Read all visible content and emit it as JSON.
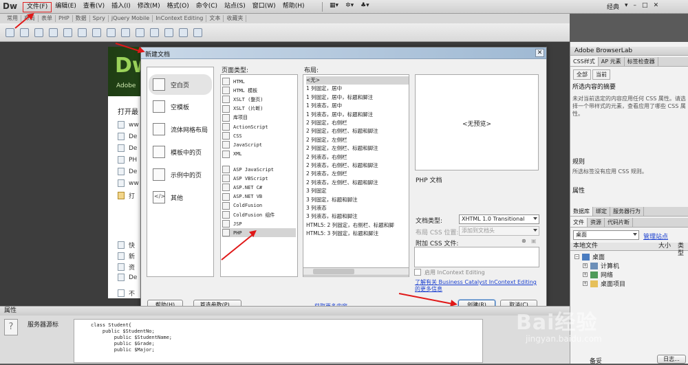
{
  "app": {
    "logo": "Dw"
  },
  "menubar": {
    "items": [
      "文件(F)",
      "编辑(E)",
      "查看(V)",
      "插入(I)",
      "修改(M)",
      "格式(O)",
      "命令(C)",
      "站点(S)",
      "窗口(W)",
      "帮助(H)"
    ],
    "workspace": "经典",
    "window_buttons": [
      "–",
      "□",
      "✕"
    ]
  },
  "insert_tabs": [
    "常用",
    "布局",
    "表单",
    "PHP",
    "数据",
    "Spry",
    "jQuery Mobile",
    "InContext Editing",
    "文本",
    "收藏夹"
  ],
  "welcome": {
    "dw": "Dw",
    "adobe": "Adobe",
    "open_recent": "打开最",
    "recent_files": [
      "ww",
      "De",
      "De",
      "PH",
      "De",
      "ww",
      "打"
    ],
    "lower_items": [
      "快",
      "新",
      "资",
      "De"
    ],
    "no_show": "不"
  },
  "dialog": {
    "title": "新建文档",
    "categories": [
      "空白页",
      "空模板",
      "流体网格布局",
      "模板中的页",
      "示例中的页",
      "其他"
    ],
    "page_type_label": "页面类型:",
    "page_types_a": [
      "HTML",
      "HTML 模板",
      "XSLT (整页)",
      "XSLT (片断)",
      "库项目",
      "ActionScript",
      "CSS",
      "JavaScript",
      "XML"
    ],
    "page_types_b": [
      "ASP JavaScript",
      "ASP VBScript",
      "ASP.NET C#",
      "ASP.NET VB",
      "ColdFusion",
      "ColdFusion 组件",
      "JSP",
      "PHP"
    ],
    "layout_label": "布局:",
    "layouts": [
      "<无>",
      "1 列固定，居中",
      "1 列固定，居中，标题和脚注",
      "1 列液态，居中",
      "1 列液态，居中，标题和脚注",
      "2 列固定，右侧栏",
      "2 列固定，右侧栏、标题和脚注",
      "2 列固定，左侧栏",
      "2 列固定，左侧栏、标题和脚注",
      "2 列液态，右侧栏",
      "2 列液态，右侧栏、标题和脚注",
      "2 列液态，左侧栏",
      "2 列液态，左侧栏、标题和脚注",
      "3 列固定",
      "3 列固定，标题和脚注",
      "3 列液态",
      "3 列液态，标题和脚注",
      "HTML5: 2 列固定，右侧栏、标题和脚",
      "HTML5: 3 列固定，标题和脚注"
    ],
    "preview_text": "<无预览>",
    "description": "PHP 文档",
    "doctype_label": "文档类型:",
    "doctype_value": "XHTML 1.0 Transitional",
    "css_layout_label": "布局 CSS 位置:",
    "css_layout_value": "添加到文档头",
    "attach_css_label": "附加 CSS 文件:",
    "incontext_label": "启用 InContext Editing",
    "bc_link": "了解有关 Business Catalyst InContext Editing 的更多信息",
    "help_button": "帮助(H)",
    "prefs_button": "首选参数(P)...",
    "more_link": "获取更多内容...",
    "create_button": "创建(R)",
    "cancel_button": "取消(C)",
    "close": "✕"
  },
  "right_panel": {
    "browserlab": "Adobe BrowserLab",
    "css_tabs": [
      "CSS样式",
      "AP 元素",
      "标签检查器"
    ],
    "subtabs": [
      "全部",
      "当前"
    ],
    "summary_title": "所选内容的摘要",
    "summary_text": "未对当前选定的内容应用任何 CSS 属性。请选择一个带样式的元素，查看应用了哪些 CSS 属性。",
    "rules_title": "规则",
    "rules_text": "所选标签没有应用 CSS 规则。",
    "props_title": "属性",
    "db_tabs": [
      "数据库",
      "绑定",
      "服务器行为"
    ],
    "file_tabs": [
      "文件",
      "资源",
      "代码片断"
    ],
    "site_select": "桌面",
    "manage_sites": "管理站点",
    "local_files": "本地文件",
    "size": "大小",
    "type": "类型",
    "tree": [
      "桌面",
      "计算机",
      "网络",
      "桌面项目"
    ],
    "backup": "备妥",
    "log": "日志..."
  },
  "props_panel": {
    "title": "属性",
    "label": "服务器源标",
    "code": "class Student{\n    public $StudentNo;\n        public $StudentName;\n        public $Grade;\n        public $Major;"
  },
  "watermark": {
    "brand": "Bai经验",
    "url": "jingyan.baidu.com"
  },
  "colors": {
    "arrow": "#e01818",
    "dw_green": "#9bd35a",
    "link": "#1a3fcf"
  }
}
